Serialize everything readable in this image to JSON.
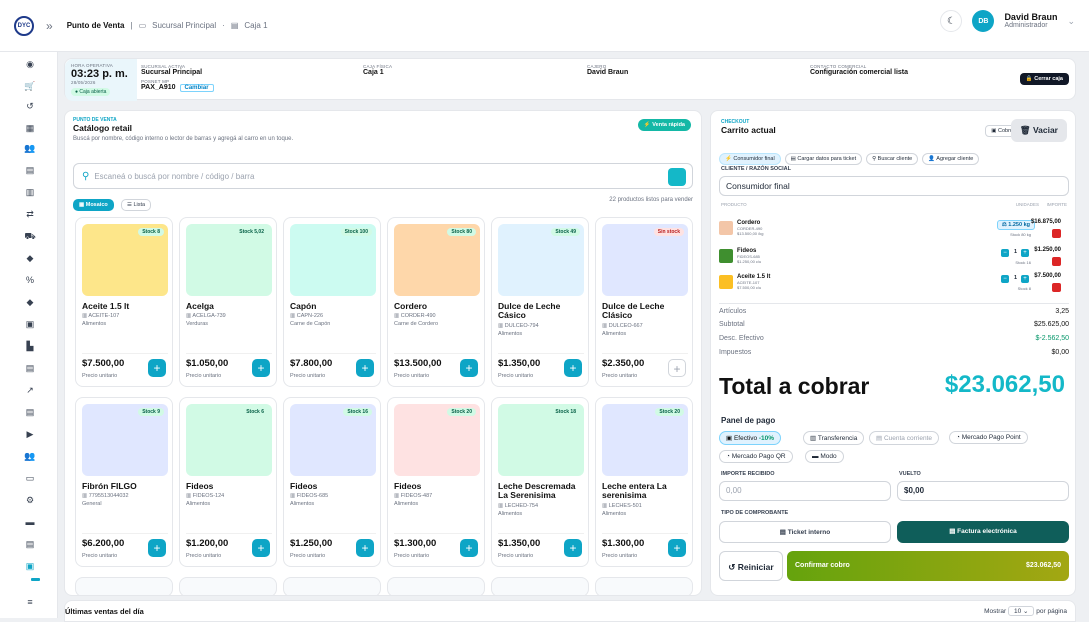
{
  "app": {
    "logo_text": "DYC",
    "breadcrumb_main": "Punto de Venta",
    "branch": "Sucursal Principal",
    "register": "Caja 1"
  },
  "user": {
    "initials": "DB",
    "name": "David Braun",
    "role": "Administrador"
  },
  "info": {
    "hora_label": "HORA OPERATIVA",
    "time": "03:23 p. m.",
    "date": "28/05/2026",
    "status": "Caja abierta",
    "sucursal_label": "SUCURSAL ACTIVA",
    "sucursal": "Sucursal Principal",
    "caja_label": "CAJA FÍSICA",
    "caja": "Caja 1",
    "cajero_label": "CAJERO",
    "cajero": "David Braun",
    "contacto_label": "CONTACTO COMERCIAL",
    "contacto": "Configuración comercial lista",
    "posnet_label": "POSNET MP",
    "posnet": "PAX_A910",
    "cambiar": "Cambiar",
    "cerrar": "Cerrar caja"
  },
  "catalog": {
    "section": "PUNTO DE VENTA",
    "title": "Catálogo retail",
    "subtitle": "Buscá por nombre, código interno o lector de barras y agregá al carro en un toque.",
    "venta_rapida": "Venta rápida",
    "search_placeholder": "Escaneá o buscá por nombre / código / barra",
    "mosaico": "Mosaico",
    "lista": "Lista",
    "count": "22 productos listos para vender"
  },
  "products": [
    {
      "name": "Aceite 1.5 lt",
      "code": "ACEITE-107",
      "cat": "Alimentos",
      "price": "$7.500,00",
      "stock": "Stock 8",
      "out": false,
      "color": "#fde68a"
    },
    {
      "name": "Acelga",
      "code": "ACELGA-739",
      "cat": "Verduras",
      "price": "$1.050,00",
      "stock": "Stock 5,02",
      "out": false,
      "color": "#d1fae5"
    },
    {
      "name": "Capón",
      "code": "CAPN-226",
      "cat": "Carne de Capón",
      "price": "$7.800,00",
      "stock": "Stock 100",
      "out": false,
      "color": "#ccfbf1"
    },
    {
      "name": "Cordero",
      "code": "CORDER-490",
      "cat": "Carne de Cordero",
      "price": "$13.500,00",
      "stock": "Stock 80",
      "out": false,
      "color": "#fed7aa"
    },
    {
      "name": "Dulce de Leche Cásico",
      "code": "DULCEO-794",
      "cat": "Alimentos",
      "price": "$1.350,00",
      "stock": "Stock 49",
      "out": false,
      "color": "#e0f2fe"
    },
    {
      "name": "Dulce de Leche Clásico",
      "code": "DULCEO-667",
      "cat": "Alimentos",
      "price": "$2.350,00",
      "stock": "Sin stock",
      "out": true,
      "color": "#e0e7ff"
    },
    {
      "name": "Fibrón FILGO",
      "code": "7795513044032",
      "cat": "General",
      "price": "$6.200,00",
      "stock": "Stock 9",
      "out": false,
      "color": "#e0e7ff"
    },
    {
      "name": "Fideos",
      "code": "FIDEOS-124",
      "cat": "Alimentos",
      "price": "$1.200,00",
      "stock": "Stock 6",
      "out": false,
      "color": "#d1fae5"
    },
    {
      "name": "Fideos",
      "code": "FIDEOS-685",
      "cat": "Alimentos",
      "price": "$1.250,00",
      "stock": "Stock 16",
      "out": false,
      "color": "#e0e7ff"
    },
    {
      "name": "Fideos",
      "code": "FIDEOS-487",
      "cat": "Alimentos",
      "price": "$1.300,00",
      "stock": "Stock 20",
      "out": false,
      "color": "#fee2e2"
    },
    {
      "name": "Leche Descremada La Serenisima",
      "code": "LECHED-754",
      "cat": "Alimentos",
      "price": "$1.350,00",
      "stock": "Stock 18",
      "out": false,
      "color": "#d1fae5"
    },
    {
      "name": "Leche entera La serenisima",
      "code": "LECHES-501",
      "cat": "Alimentos",
      "price": "$1.300,00",
      "stock": "Stock 20",
      "out": false,
      "color": "#e0e7ff"
    }
  ],
  "checkout": {
    "section": "CHECKOUT",
    "title": "Carrito actual",
    "cobro": "Cobro",
    "vaciar": "Vaciar",
    "tabs": [
      "Consumidor final",
      "Cargar datos para ticket",
      "Buscar cliente",
      "Agregar cliente"
    ],
    "cliente_label": "CLIENTE / RAZÓN SOCIAL",
    "cliente": "Consumidor final",
    "th_producto": "PRODUCTO",
    "th_unidades": "UNIDADES",
    "th_importe": "IMPORTE",
    "items": [
      {
        "name": "Cordero",
        "code": "CORDER-490",
        "unit": "$13.500,00 /kg",
        "qty": "1.250 kg",
        "stock": "Stock 80 kg",
        "amount": "$16.875,00"
      },
      {
        "name": "Fideos",
        "code": "FIDEOS-685",
        "unit": "$1.250,00 c/u",
        "qty": "1",
        "stock": "Stock 16",
        "amount": "$1.250,00"
      },
      {
        "name": "Aceite 1.5 lt",
        "code": "ACEITE-107",
        "unit": "$7.500,00 c/u",
        "qty": "1",
        "stock": "Stock 8",
        "amount": "$7.500,00"
      }
    ],
    "summary": [
      {
        "label": "Artículos",
        "value": "3,25"
      },
      {
        "label": "Subtotal",
        "value": "$25.625,00"
      },
      {
        "label": "Desc. Efectivo",
        "value": "$-2.562,50"
      },
      {
        "label": "Impuestos",
        "value": "$0,00"
      }
    ],
    "total_label": "Total a cobrar",
    "total": "$23.062,50",
    "panel_pago": "Panel de pago",
    "methods": [
      "Efectivo",
      "Transferencia",
      "Cuenta corriente",
      "Mercado Pago Point",
      "Mercado Pago QR",
      "Modo"
    ],
    "descuento": "-10%",
    "importe_label": "IMPORTE RECIBIDO",
    "importe_ph": "0,00",
    "vuelto_label": "VUELTO",
    "vuelto": "$0,00",
    "tipo_label": "TIPO DE COMPROBANTE",
    "ticket": "Ticket interno",
    "factura": "Factura electrónica",
    "reiniciar": "Reiniciar",
    "confirmar": "Confirmar cobro",
    "confirm_amount": "$23.062,50"
  },
  "bottom": {
    "title": "Últimas ventas del día",
    "mostrar": "Mostrar",
    "per_page": "10",
    "por_pagina": "por página"
  }
}
